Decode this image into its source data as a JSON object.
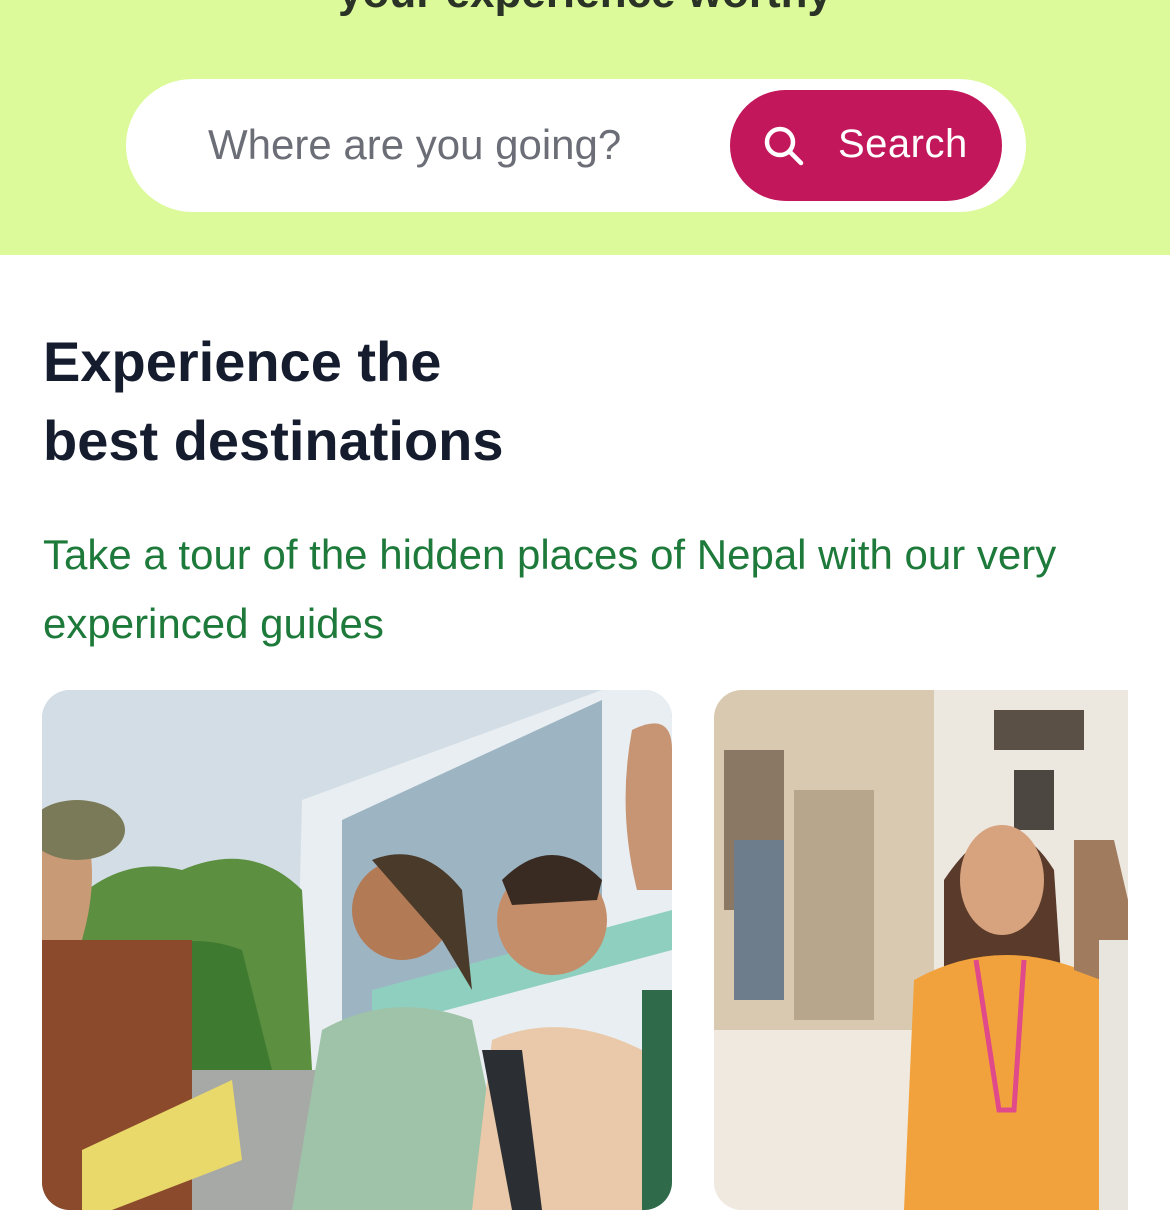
{
  "hero": {
    "heading": "your experience worthy",
    "background_color": "#dcfa9a"
  },
  "search": {
    "placeholder": "Where are you going?",
    "button_label": "Search",
    "button_icon": "search-icon",
    "button_color": "#c2185b"
  },
  "section": {
    "title_line1": "Experience the",
    "title_line2": "best destinations",
    "subtitle": "Take a tour of the hidden places of Nepal with our very experinced guides"
  },
  "cards": [
    {
      "image": "tour-guide-with-group-photo"
    },
    {
      "image": "smiling-guide-in-old-town-photo"
    }
  ]
}
